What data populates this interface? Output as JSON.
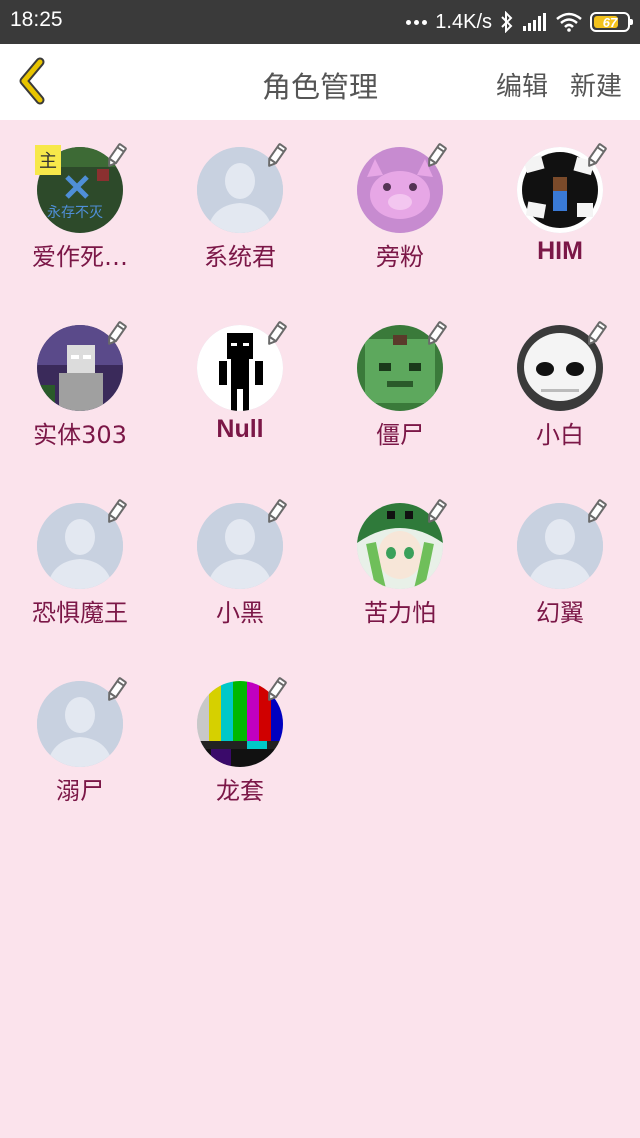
{
  "status_bar": {
    "time": "18:25",
    "network_speed": "1.4K/s",
    "battery_level": "67",
    "icons": [
      "dots-icon",
      "bluetooth-icon",
      "signal-icon",
      "wifi-icon",
      "battery-icon"
    ]
  },
  "header": {
    "title": "角色管理",
    "edit_label": "编辑",
    "new_label": "新建",
    "back_icon": "chevron-left-icon"
  },
  "roles": [
    {
      "name": "爱作死…",
      "avatar": "chalkboard",
      "badge": "主"
    },
    {
      "name": "系统君",
      "avatar": "default"
    },
    {
      "name": "旁粉",
      "avatar": "pink-pig"
    },
    {
      "name": "HIM",
      "avatar": "him"
    },
    {
      "name": "实体303",
      "avatar": "entity303"
    },
    {
      "name": "Null",
      "avatar": "null"
    },
    {
      "name": "僵尸",
      "avatar": "zombie"
    },
    {
      "name": "小白",
      "avatar": "skull"
    },
    {
      "name": "恐惧魔王",
      "avatar": "default"
    },
    {
      "name": "小黑",
      "avatar": "default"
    },
    {
      "name": "苦力怕",
      "avatar": "creeper-girl"
    },
    {
      "name": "幻翼",
      "avatar": "default"
    },
    {
      "name": "溺尸",
      "avatar": "default"
    },
    {
      "name": "龙套",
      "avatar": "tv-test"
    }
  ],
  "colors": {
    "background": "#fbe3ec",
    "role_name": "#7b1747",
    "back_icon": "#e8c400",
    "status_bar": "#3a3a3a"
  }
}
